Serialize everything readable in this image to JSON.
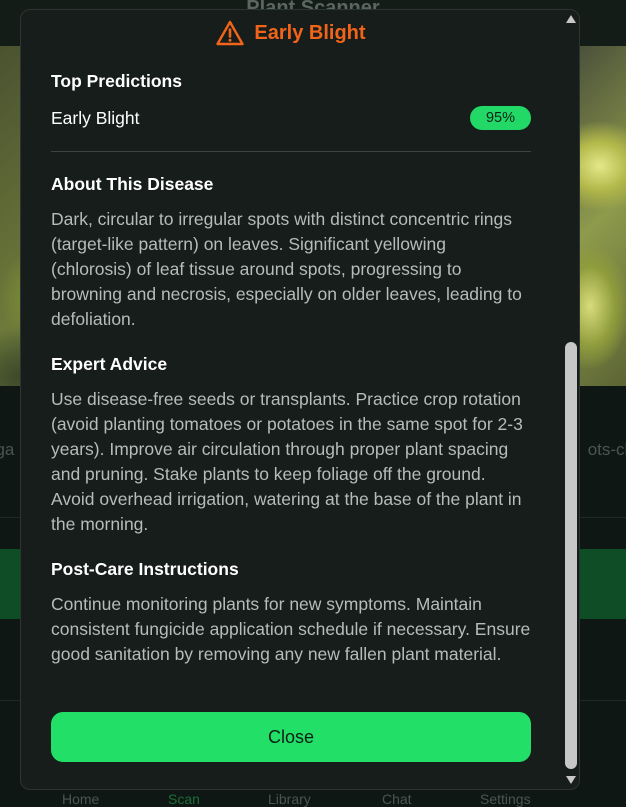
{
  "background": {
    "app_title": "Plant Scanner",
    "left_text": "nga",
    "right_text": "ots-ch",
    "nav": [
      "Home",
      "Scan",
      "Library",
      "Chat",
      "Settings"
    ]
  },
  "modal": {
    "title": "Early Blight",
    "title_color": "#f26419",
    "warning_icon": "warning-triangle-icon",
    "top_predictions": {
      "heading": "Top Predictions",
      "items": [
        {
          "name": "Early Blight",
          "confidence": "95%"
        }
      ]
    },
    "about": {
      "heading": "About This Disease",
      "text": "Dark, circular to irregular spots with distinct concentric rings (target-like pattern) on leaves. Significant yellowing (chlorosis) of leaf tissue around spots, progressing to browning and necrosis, especially on older leaves, leading to defoliation."
    },
    "advice": {
      "heading": "Expert Advice",
      "text": "Use disease-free seeds or transplants. Practice crop rotation (avoid planting tomatoes or potatoes in the same spot for 2-3 years). Improve air circulation through proper plant spacing and pruning. Stake plants to keep foliage off the ground. Avoid overhead irrigation, watering at the base of the plant in the morning."
    },
    "post_care": {
      "heading": "Post-Care Instructions",
      "text": "Continue monitoring plants for new symptoms. Maintain consistent fungicide application schedule if necessary. Ensure good sanitation by removing any new fallen plant material."
    },
    "close_label": "Close",
    "accent_color": "#22df68"
  }
}
